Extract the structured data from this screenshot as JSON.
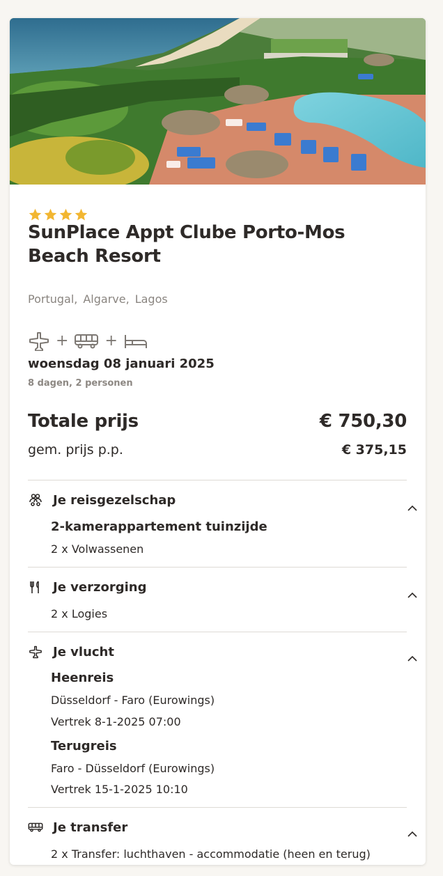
{
  "hotel": {
    "stars": 4,
    "name": "SunPlace Appt Clube Porto-Mos Beach Resort",
    "location": [
      "Portugal",
      "Algarve",
      "Lagos"
    ]
  },
  "trip": {
    "modes": [
      "plane-icon",
      "bus-icon",
      "bed-icon"
    ],
    "date": "woensdag 08 januari 2025",
    "meta": "8 dagen, 2 personen"
  },
  "price": {
    "total_label": "Totale prijs",
    "total_value": "€ 750,30",
    "pp_label": "gem. prijs p.p.",
    "pp_value": "€ 375,15"
  },
  "sections": {
    "party": {
      "title": "Je reisgezelschap",
      "room": "2-kamerappartement tuinzijde",
      "guests": "2 x Volwassenen"
    },
    "board": {
      "title": "Je verzorging",
      "value": "2 x Logies"
    },
    "flight": {
      "title": "Je vlucht",
      "outbound_title": "Heenreis",
      "outbound_route": "Düsseldorf - Faro (Eurowings)",
      "outbound_departure": "Vertrek 8-1-2025 07:00",
      "return_title": "Terugreis",
      "return_route": "Faro - Düsseldorf (Eurowings)",
      "return_departure": "Vertrek 15-1-2025 10:10"
    },
    "transfer": {
      "title": "Je transfer",
      "value": "2 x Transfer: luchthaven - accommodatie (heen en terug)"
    }
  },
  "colors": {
    "star": "#f2b631",
    "text": "#2e2a28",
    "muted": "#8a8580",
    "divider": "#dedad5",
    "background": "#f8f6f2"
  }
}
